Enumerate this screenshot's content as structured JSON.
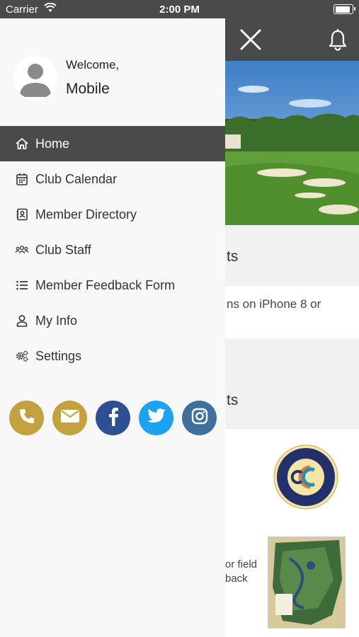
{
  "status_bar": {
    "carrier": "Carrier",
    "time": "2:00 PM",
    "battery_level": 0.9
  },
  "profile": {
    "welcome": "Welcome,",
    "name": "Mobile"
  },
  "menu": {
    "items": [
      {
        "label": "Home",
        "icon": "home-icon",
        "active": true
      },
      {
        "label": "Club Calendar",
        "icon": "calendar-icon"
      },
      {
        "label": "Member Directory",
        "icon": "contact-book-icon"
      },
      {
        "label": "Club Staff",
        "icon": "group-icon"
      },
      {
        "label": "Member Feedback Form",
        "icon": "list-icon"
      },
      {
        "label": "My Info",
        "icon": "user-icon"
      },
      {
        "label": "Settings",
        "icon": "gears-icon"
      }
    ]
  },
  "social": [
    {
      "name": "phone",
      "icon": "phone-icon",
      "color": "#c2a13e"
    },
    {
      "name": "email",
      "icon": "mail-icon",
      "color": "#c2a13e"
    },
    {
      "name": "facebook",
      "icon": "facebook-icon",
      "color": "#2e4f93"
    },
    {
      "name": "twitter",
      "icon": "twitter-icon",
      "color": "#1da1f2"
    },
    {
      "name": "instagram",
      "icon": "instagram-icon",
      "color": "#3f6f9c"
    }
  ],
  "background": {
    "section1_text": "ts",
    "section2_text": "ns on iPhone 8 or",
    "section3_text": "ts",
    "section5_line1": "or field",
    "section5_line2": "back"
  },
  "colors": {
    "header": "#4a4a4a",
    "active_item": "#4a4a4a",
    "gold": "#c2a13e"
  }
}
